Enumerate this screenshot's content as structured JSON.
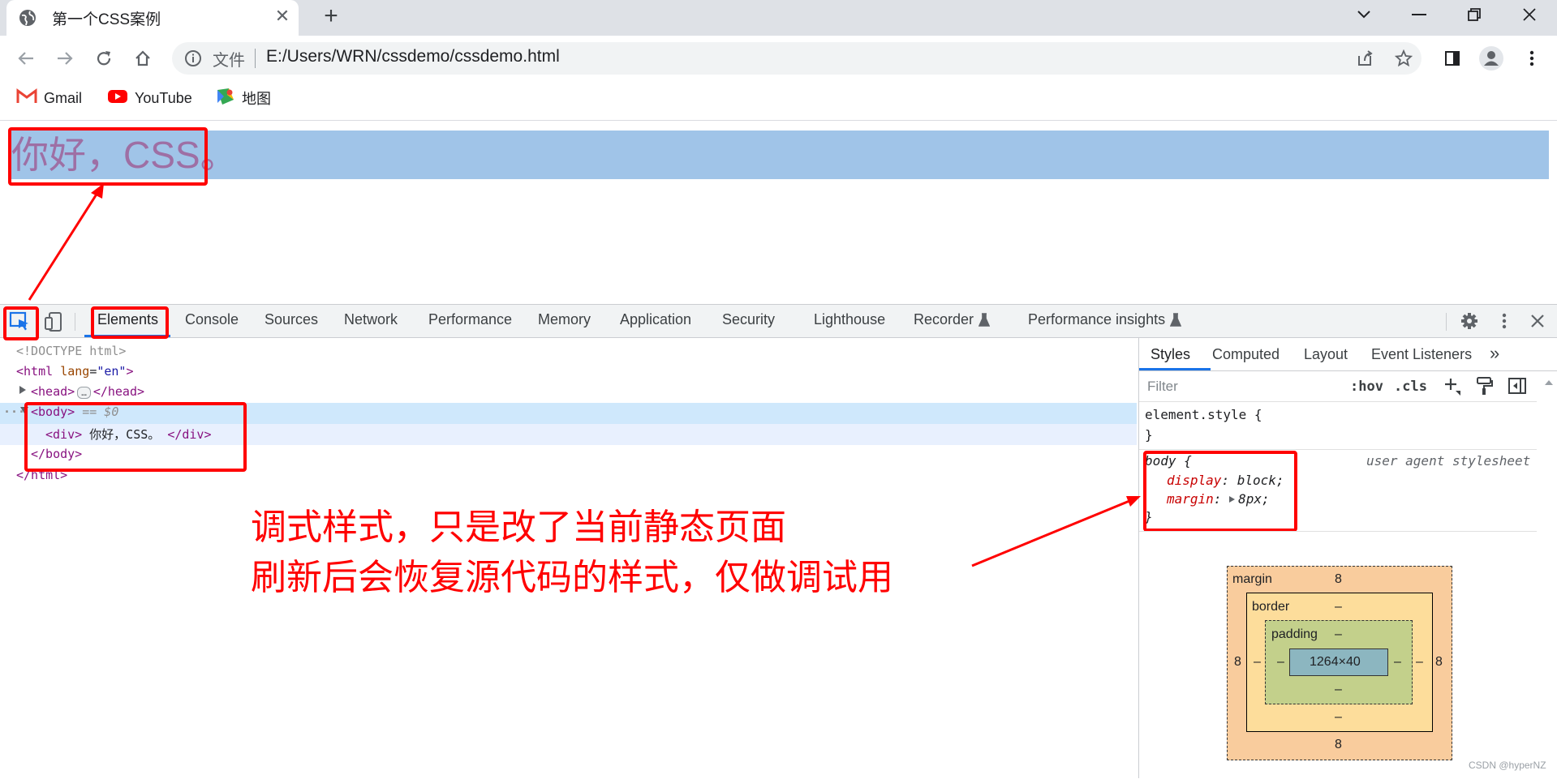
{
  "browser": {
    "tab_title": "第一个CSS案例",
    "omnibox_prefix": "文件",
    "url": "E:/Users/WRN/cssdemo/cssdemo.html",
    "bookmarks": [
      {
        "label": "Gmail",
        "icon": "gmail-icon"
      },
      {
        "label": "YouTube",
        "icon": "youtube-icon"
      },
      {
        "label": "地图",
        "icon": "maps-icon"
      }
    ]
  },
  "page": {
    "div_text": "你好，CSS。",
    "div_background": "#a0c4e8",
    "text_color": "#9e6fa4"
  },
  "devtools": {
    "tabs": [
      "Elements",
      "Console",
      "Sources",
      "Network",
      "Performance",
      "Memory",
      "Application",
      "Security",
      "Lighthouse",
      "Recorder",
      "Performance insights"
    ],
    "active_tab": "Elements",
    "dom": {
      "doctype": "<!DOCTYPE html>",
      "html_open_tag": "html",
      "html_attr_name": "lang",
      "html_attr_value": "\"en\"",
      "head_open": "<head>",
      "head_ellipsis": "…",
      "head_close": "</head>",
      "body_open": "<body>",
      "body_marker": "== $0",
      "div_open": "<div>",
      "div_text": " 你好，CSS。 ",
      "div_close": "</div>",
      "body_close": "</body>",
      "html_close": "</html>",
      "row_dots": "···"
    },
    "styles_pane": {
      "tabs": [
        "Styles",
        "Computed",
        "Layout",
        "Event Listeners"
      ],
      "more": "»",
      "filter_placeholder": "Filter",
      "hov": ":hov",
      "cls": ".cls",
      "element_style_open": "element.style {",
      "element_style_close": "}",
      "rule_selector": "body {",
      "rule_source": "user agent stylesheet",
      "declarations": [
        {
          "prop": "display",
          "value": "block;"
        },
        {
          "prop": "margin",
          "value": "8px;"
        }
      ],
      "rule_close": "}"
    },
    "box_model": {
      "margin_label": "margin",
      "margin_top": "8",
      "margin_bottom": "8",
      "margin_left": "8",
      "margin_right": "8",
      "border_label": "border",
      "border_top": "–",
      "border_bottom": "–",
      "border_left": "–",
      "border_right": "–",
      "padding_label": "padding",
      "padding_top": "–",
      "padding_bottom": "–",
      "padding_left": "–",
      "padding_right": "–",
      "content_size": "1264×40"
    }
  },
  "annotation": {
    "line1": "调式样式，只是改了当前静态页面",
    "line2": "刷新后会恢复源代码的样式，仅做调试用",
    "color": "#ff0000"
  },
  "watermark": "CSDN @hyperNZ"
}
